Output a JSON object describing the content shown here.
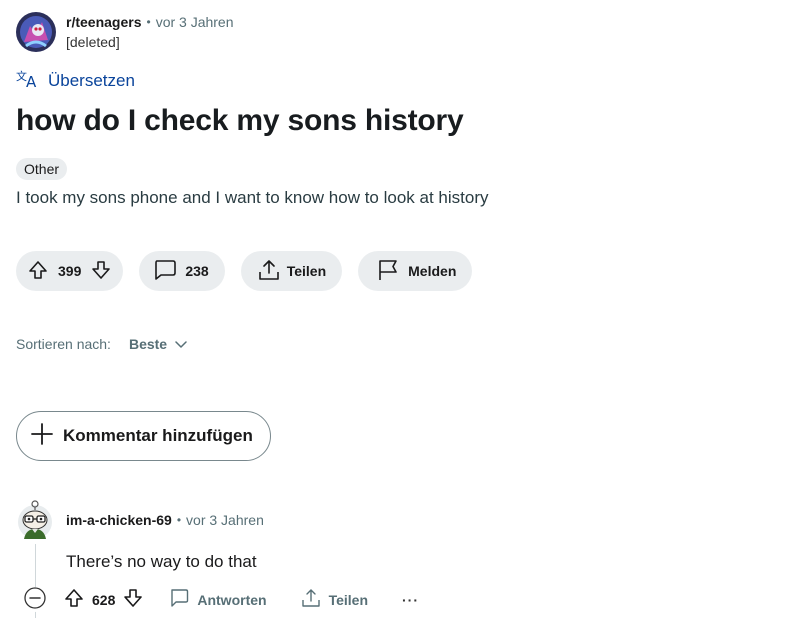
{
  "post": {
    "subreddit": "r/teenagers",
    "separator": "•",
    "time": "vor 3 Jahren",
    "author": "[deleted]",
    "translate_label": "Übersetzen",
    "title": "how do I check my sons history",
    "flair": "Other",
    "body": "I took my sons phone and I want to know how to look at history"
  },
  "actions": {
    "votes": "399",
    "comments": "238",
    "share_label": "Teilen",
    "report_label": "Melden"
  },
  "sort": {
    "label": "Sortieren nach:",
    "value": "Beste"
  },
  "add_comment_label": "Kommentar hinzufügen",
  "comment": {
    "author": "im-a-chicken-69",
    "separator": "•",
    "time": "vor 3 Jahren",
    "text": "There’s no way to do that",
    "votes": "628",
    "reply_label": "Antworten",
    "share_label": "Teilen",
    "more_label": "···"
  },
  "colors": {
    "link_blue": "#0a449b",
    "pill_bg": "#eaedef",
    "muted": "#576f76"
  }
}
